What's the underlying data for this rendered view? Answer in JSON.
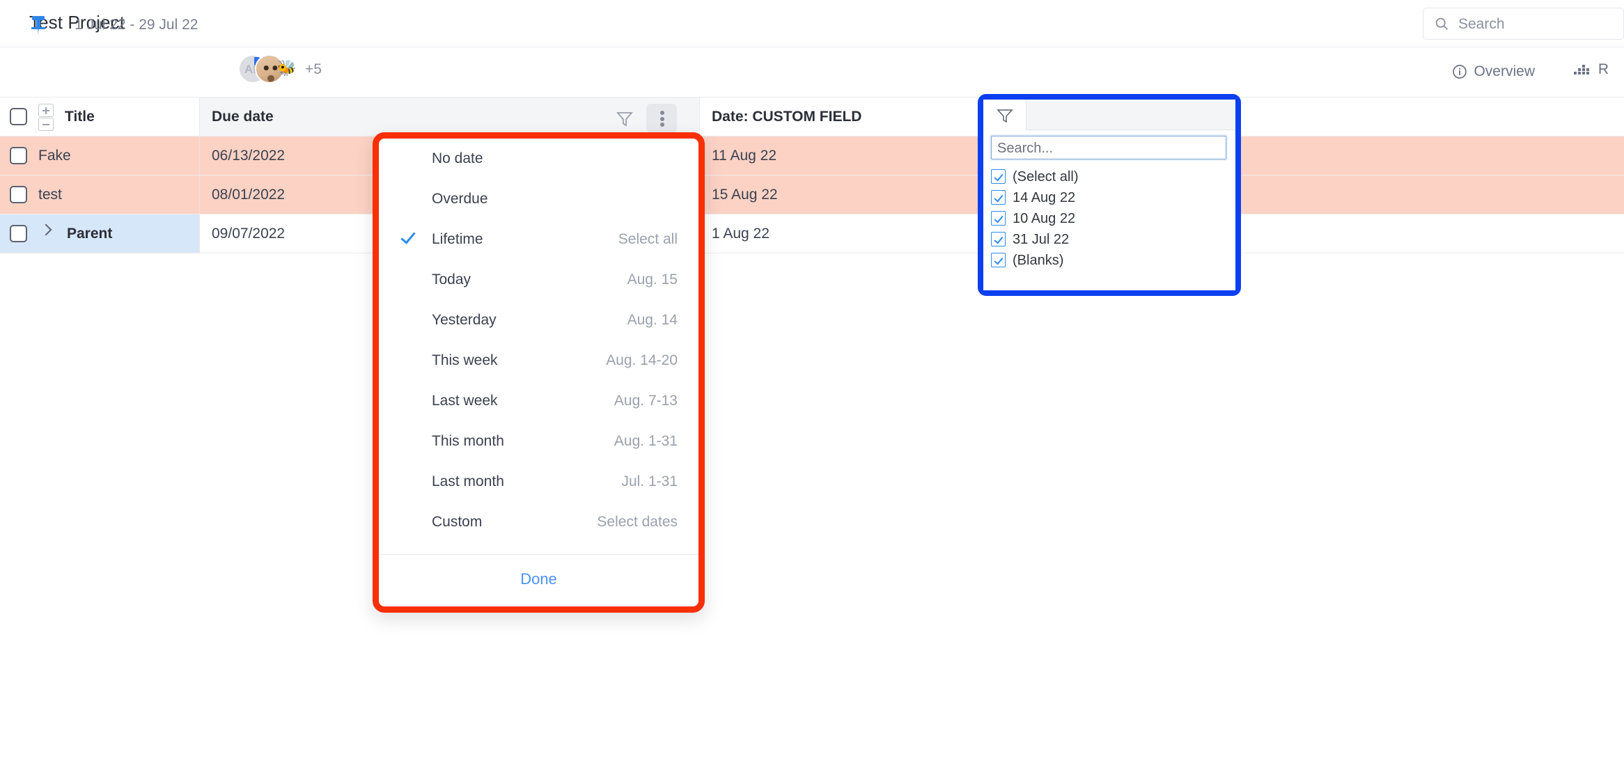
{
  "header": {
    "project_title": "Test Project",
    "search": {
      "placeholder": "Search",
      "icon": "search-icon"
    }
  },
  "subheader": {
    "pin_icon": "pin-icon",
    "date_range": "1 Jul 22 - 29 Jul 22",
    "avatar_initials": "AB",
    "avatar_overflow": "+5",
    "bee_icon": "bee-icon",
    "overview_label": "Overview",
    "overview_icon": "info-circle-icon",
    "report_label": "R",
    "report_icon": "bar-chart-icon"
  },
  "table": {
    "columns": [
      {
        "key": "title",
        "label": "Title"
      },
      {
        "key": "due",
        "label": "Due date"
      },
      {
        "key": "custom",
        "label": "Date: CUSTOM FIELD"
      }
    ],
    "header_icons": {
      "select_all_checkbox": "checkbox-icon",
      "expand_all": "expand-rows-icon",
      "collapse_all": "collapse-rows-icon",
      "filter": "funnel-icon",
      "menu": "kebab-menu-icon"
    },
    "rows": [
      {
        "title": "Fake",
        "due": "06/13/2022",
        "custom": "11 Aug 22",
        "highlight": "red",
        "bold": false,
        "expandable": false
      },
      {
        "title": "test",
        "due": "08/01/2022",
        "custom": "15 Aug 22",
        "highlight": "red",
        "bold": false,
        "expandable": false
      },
      {
        "title": "Parent",
        "due": "09/07/2022",
        "custom": "1 Aug 22",
        "highlight": "blue",
        "bold": true,
        "expandable": true
      }
    ]
  },
  "date_filter_menu": {
    "highlight_color": "#f92f06",
    "items": [
      {
        "label": "No date",
        "hint": "",
        "checked": false
      },
      {
        "label": "Overdue",
        "hint": "",
        "checked": false
      },
      {
        "label": "Lifetime",
        "hint": "Select all",
        "checked": true
      },
      {
        "label": "Today",
        "hint": "Aug. 15",
        "checked": false
      },
      {
        "label": "Yesterday",
        "hint": "Aug. 14",
        "checked": false
      },
      {
        "label": "This week",
        "hint": "Aug. 14-20",
        "checked": false
      },
      {
        "label": "Last week",
        "hint": "Aug. 7-13",
        "checked": false
      },
      {
        "label": "This month",
        "hint": "Aug. 1-31",
        "checked": false
      },
      {
        "label": "Last month",
        "hint": "Jul. 1-31",
        "checked": false
      },
      {
        "label": "Custom",
        "hint": "Select dates",
        "checked": false
      }
    ],
    "done_label": "Done"
  },
  "value_filter_panel": {
    "highlight_color": "#0b3ff0",
    "tab_icon": "funnel-icon",
    "search_placeholder": "Search...",
    "options": [
      {
        "label": "(Select all)",
        "checked": true
      },
      {
        "label": "14 Aug 22",
        "checked": true
      },
      {
        "label": "10 Aug 22",
        "checked": true
      },
      {
        "label": "31 Jul 22",
        "checked": true
      },
      {
        "label": "(Blanks)",
        "checked": true
      }
    ]
  }
}
